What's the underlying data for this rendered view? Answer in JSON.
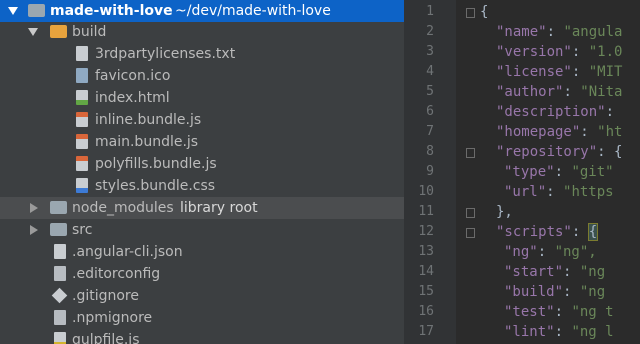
{
  "project": {
    "name": "made-with-love",
    "path": "~/dev/made-with-love"
  },
  "tree": {
    "build_label": "build",
    "build_files": [
      "3rdpartylicenses.txt",
      "favicon.ico",
      "index.html",
      "inline.bundle.js",
      "main.bundle.js",
      "polyfills.bundle.js",
      "styles.bundle.css"
    ],
    "node_modules_label": "node_modules",
    "library_root_label": "library root",
    "src_label": "src",
    "root_files": [
      ".angular-cli.json",
      ".editorconfig",
      ".gitignore",
      ".npmignore",
      "gulpfile.js"
    ]
  },
  "editor": {
    "line_numbers": [
      "1",
      "2",
      "3",
      "4",
      "5",
      "6",
      "7",
      "8",
      "9",
      "10",
      "11",
      "12",
      "13",
      "14",
      "15",
      "16",
      "17"
    ],
    "lines": [
      {
        "t": "{"
      },
      {
        "k": "\"name\"",
        "c": ": ",
        "v": "\"angula"
      },
      {
        "k": "\"version\"",
        "c": ": ",
        "v": "\"1.0"
      },
      {
        "k": "\"license\"",
        "c": ": ",
        "v": "\"MIT"
      },
      {
        "k": "\"author\"",
        "c": ": ",
        "v": "\"Nita"
      },
      {
        "k": "\"description\"",
        "c": ": ",
        "v": ""
      },
      {
        "k": "\"homepage\"",
        "c": ": ",
        "v": "\"ht"
      },
      {
        "k": "\"repository\"",
        "c": ": {",
        "v": ""
      },
      {
        "k": "\"type\"",
        "c": ": ",
        "v": "\"git\""
      },
      {
        "k": "\"url\"",
        "c": ": ",
        "v": "\"https"
      },
      {
        "t": "},"
      },
      {
        "k": "\"scripts\"",
        "c": ": {",
        "v": ""
      },
      {
        "k": "\"ng\"",
        "c": ": ",
        "v": "\"ng\","
      },
      {
        "k": "\"start\"",
        "c": ": ",
        "v": "\"ng"
      },
      {
        "k": "\"build\"",
        "c": ": ",
        "v": "\"ng"
      },
      {
        "k": "\"test\"",
        "c": ": ",
        "v": "\"ng t"
      },
      {
        "k": "\"lint\"",
        "c": ": ",
        "v": "\"ng l"
      }
    ]
  },
  "colors": {
    "selection": "#0d63c7",
    "folder_orange": "#e8a33d",
    "folder_gray": "#9aa7b0",
    "key_purple": "#9876aa",
    "string_green": "#6a8759"
  }
}
